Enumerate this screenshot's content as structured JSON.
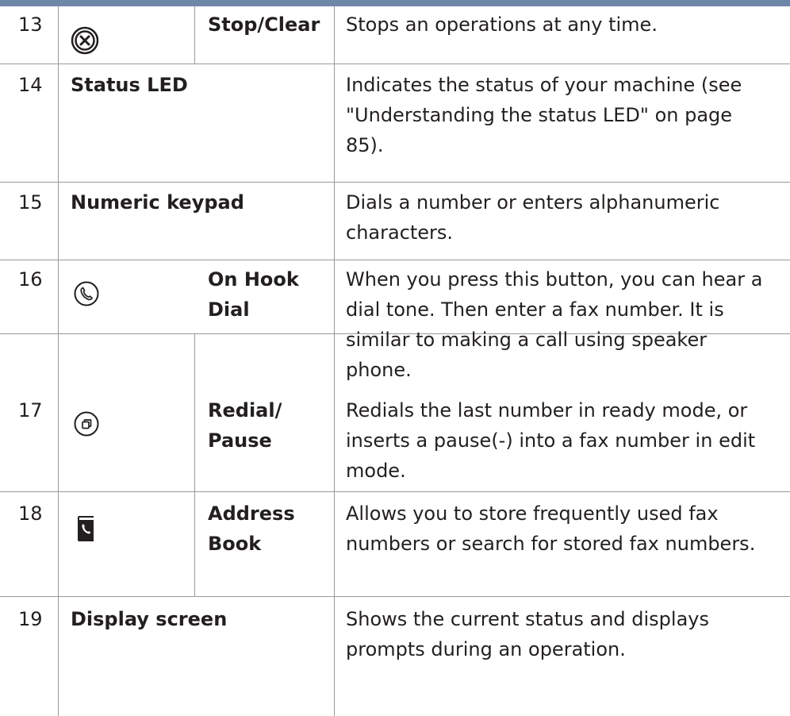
{
  "table": {
    "rows": [
      {
        "number": "13",
        "icon": "stop-clear-icon",
        "name": "Stop/Clear",
        "description": [
          "Stops an operations at any time."
        ]
      },
      {
        "number": "14",
        "icon": null,
        "name": "Status LED",
        "description": [
          "Indicates the status of your machine (see",
          "\"Understanding the status LED\" on page",
          "85)."
        ]
      },
      {
        "number": "15",
        "icon": null,
        "name": "Numeric keypad",
        "description": [
          "Dials a number or enters alphanumeric",
          "characters."
        ]
      },
      {
        "number": "16",
        "icon": "on-hook-dial-icon",
        "name": [
          "On Hook",
          "Dial"
        ],
        "description": [
          "When you press this button, you can hear a",
          "dial tone. Then enter a fax number. It is",
          "similar to making a call using speaker",
          "phone."
        ]
      },
      {
        "number": "17",
        "icon": "redial-pause-icon",
        "name": [
          "Redial/",
          "Pause"
        ],
        "description": [
          "Redials the last number in ready mode, or",
          "inserts a pause(-) into a fax number in edit",
          "mode."
        ]
      },
      {
        "number": "18",
        "icon": "address-book-icon",
        "name": [
          "Address",
          "Book"
        ],
        "description": [
          "Allows you to store frequently used fax",
          "numbers or search for stored fax numbers."
        ]
      },
      {
        "number": "19",
        "icon": null,
        "name": "Display screen",
        "description": [
          "Shows the current status and displays",
          "prompts during an operation."
        ]
      }
    ]
  },
  "colors": {
    "top_rule": "#6e86a8",
    "grid_lines": "#9a9a9a",
    "text": "#231f20"
  }
}
